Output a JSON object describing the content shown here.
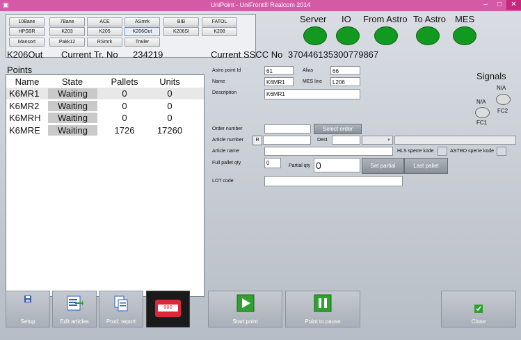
{
  "window": {
    "title": "UniPoint - UniFront® Realcom 2014"
  },
  "line_buttons": [
    {
      "label": "10Bane"
    },
    {
      "label": "7Bane"
    },
    {
      "label": "ACE"
    },
    {
      "label": "ASmrk"
    },
    {
      "label": "BIB"
    },
    {
      "label": "FATOL"
    },
    {
      "label": "HPSBR"
    },
    {
      "label": "K203"
    },
    {
      "label": "K205"
    },
    {
      "label": "K206Out"
    },
    {
      "label": "K206SI"
    },
    {
      "label": "K208"
    },
    {
      "label": "Mansort"
    },
    {
      "label": "Pakk12"
    },
    {
      "label": "RSmrk"
    },
    {
      "label": "Trailer"
    }
  ],
  "status": {
    "server": "Server",
    "io": "IO",
    "from_astro": "From Astro",
    "to_astro": "To Astro",
    "mes": "MES",
    "led_color": "#119a1f"
  },
  "info": {
    "point": "K206Out",
    "tr_label": "Current Tr. No",
    "tr_value": "234219",
    "sscc_label": "Current SSCC No",
    "sscc_value": "370446135300779867"
  },
  "points": {
    "title": "Points",
    "headers": {
      "name": "Name",
      "state": "State",
      "pallets": "Pallets",
      "units": "Units"
    },
    "rows": [
      {
        "name": "K6MR1",
        "state": "Waiting",
        "pallets": "0",
        "units": "0"
      },
      {
        "name": "K6MR2",
        "state": "Waiting",
        "pallets": "0",
        "units": "0"
      },
      {
        "name": "K6MRH",
        "state": "Waiting",
        "pallets": "0",
        "units": "0"
      },
      {
        "name": "K6MRE",
        "state": "Waiting",
        "pallets": "1726",
        "units": "17260"
      }
    ]
  },
  "form": {
    "astro_point_id_label": "Astro point Id",
    "astro_point_id": "61",
    "alias_label": "Alias",
    "alias": "66",
    "name_label": "Name",
    "name": "K6MR1",
    "mes_line_label": "MES line",
    "mes_line": "L206",
    "description_label": "Description",
    "description": "K6MR1",
    "order_number_label": "Order number",
    "order_number": "",
    "select_order_label": "Select order",
    "article_number_label": "Article number",
    "r_label": "R",
    "article_number": "",
    "dest_label": "Dest",
    "article_name_label": "Article name",
    "article_name": "",
    "hls_label": "HLS sperre kode",
    "astro_sperre_label": "ASTRO sperre kode",
    "full_pallet_qty_label": "Full pallet qty",
    "full_pallet_qty": "0",
    "partial_qty_label": "Partial qty",
    "partial_qty": "0",
    "set_partial_label": "Set partial",
    "last_pallet_label": "Last pallet",
    "lot_code_label": "LOT code",
    "lot_code": ""
  },
  "signals": {
    "title": "Signals",
    "fc2_state": "N/A",
    "fc2_label": "FC2",
    "fc1_state": "N/A",
    "fc1_label": "FC1"
  },
  "toolbar": {
    "setup": "Setup",
    "edit_articles": "Edit articles",
    "prod_report": "Prod. report",
    "counter_digits": "000",
    "start_point": "Start point",
    "point_to_pause": "Point to pause",
    "close": "Close"
  }
}
